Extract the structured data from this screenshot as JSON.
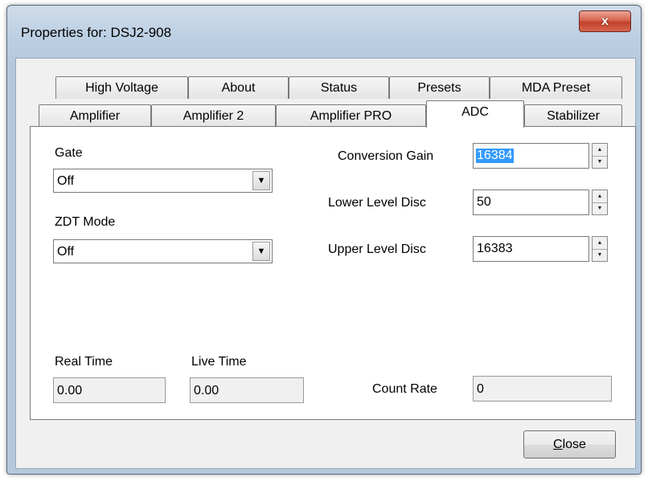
{
  "window": {
    "title": "Properties for: DSJ2-908",
    "close_glyph": "x"
  },
  "tabs_row_back": [
    {
      "label": "High Voltage"
    },
    {
      "label": "About"
    },
    {
      "label": "Status"
    },
    {
      "label": "Presets"
    },
    {
      "label": "MDA Preset"
    }
  ],
  "tabs_row_front": [
    {
      "label": "Amplifier"
    },
    {
      "label": "Amplifier 2"
    },
    {
      "label": "Amplifier PRO"
    },
    {
      "label": "ADC",
      "active": true
    },
    {
      "label": "Stabilizer"
    }
  ],
  "panel": {
    "gate": {
      "label": "Gate",
      "value": "Off"
    },
    "zdt_mode": {
      "label": "ZDT Mode",
      "value": "Off"
    },
    "conversion_gain": {
      "label": "Conversion Gain",
      "value": "16384"
    },
    "lower_level_disc": {
      "label": "Lower Level Disc",
      "value": "50"
    },
    "upper_level_disc": {
      "label": "Upper Level Disc",
      "value": "16383"
    },
    "real_time": {
      "label": "Real Time",
      "value": "0.00"
    },
    "live_time": {
      "label": "Live Time",
      "value": "0.00"
    },
    "count_rate": {
      "label": "Count Rate",
      "value": "0"
    }
  },
  "buttons": {
    "close_first": "C",
    "close_rest": "lose"
  },
  "colors": {
    "selection": "#3399ff",
    "close_button_red": "#c2412b",
    "frame_blue": "#b5c9de"
  }
}
